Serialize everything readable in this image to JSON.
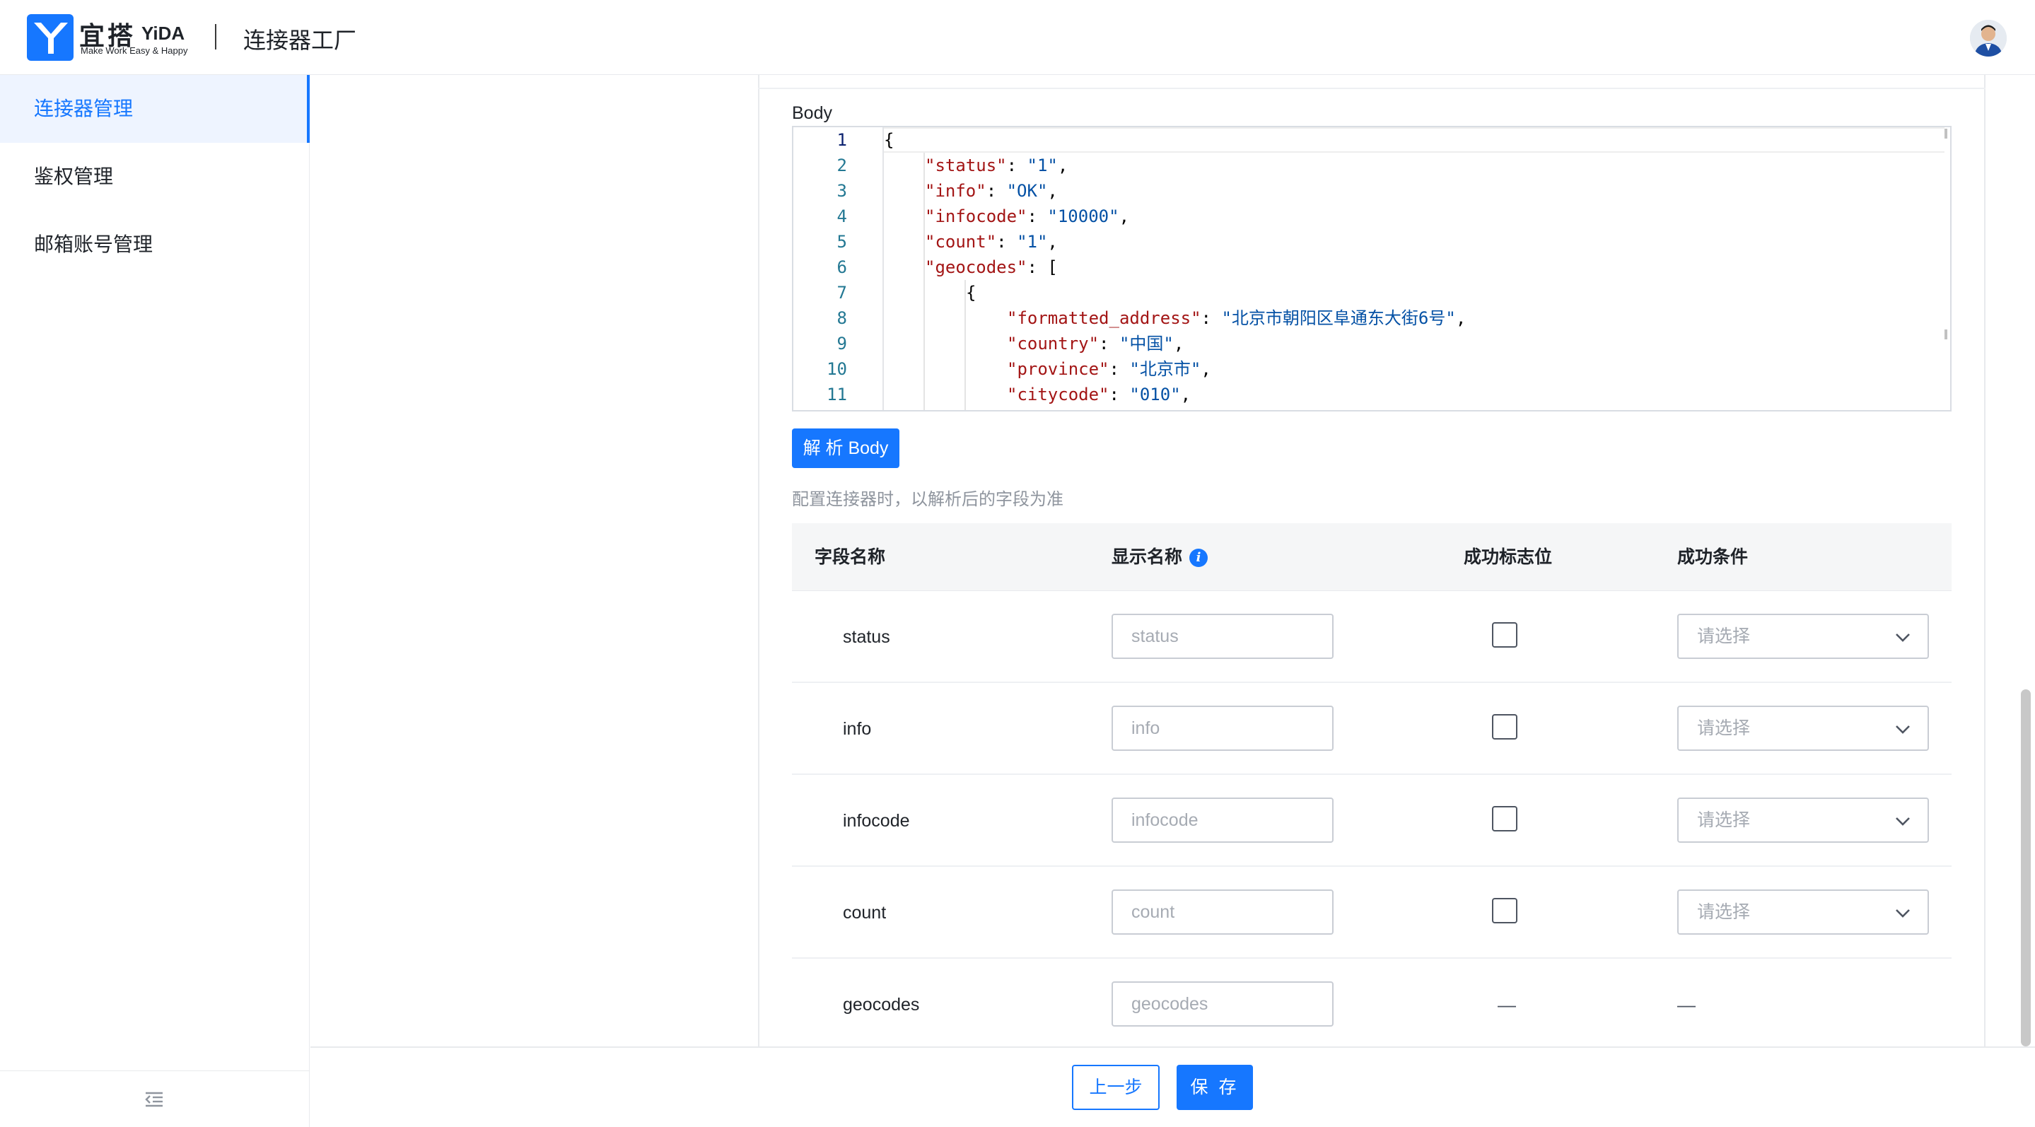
{
  "header": {
    "logo_cn": "宜搭",
    "logo_en": "YiDA",
    "logo_tagline": "Make Work Easy & Happy",
    "app_title": "连接器工厂"
  },
  "sidebar": {
    "items": [
      {
        "label": "连接器管理",
        "active": true
      },
      {
        "label": "鉴权管理",
        "active": false
      },
      {
        "label": "邮箱账号管理",
        "active": false
      }
    ]
  },
  "body_editor": {
    "label": "Body",
    "lines": [
      {
        "no": "1"
      },
      {
        "no": "2"
      },
      {
        "no": "3"
      },
      {
        "no": "4"
      },
      {
        "no": "5"
      },
      {
        "no": "6"
      },
      {
        "no": "7"
      },
      {
        "no": "8"
      },
      {
        "no": "9"
      },
      {
        "no": "10"
      },
      {
        "no": "11"
      }
    ],
    "code": {
      "l1": "{",
      "l2_key": "\"status\"",
      "l2_val": "\"1\"",
      "l3_key": "\"info\"",
      "l3_val": "\"OK\"",
      "l4_key": "\"infocode\"",
      "l4_val": "\"10000\"",
      "l5_key": "\"count\"",
      "l5_val": "\"1\"",
      "l6_key": "\"geocodes\"",
      "l6_rest": ": [",
      "l7": "{",
      "l8_key": "\"formatted_address\"",
      "l8_val": "\"北京市朝阳区阜通东大街6号\"",
      "l9_key": "\"country\"",
      "l9_val": "\"中国\"",
      "l10_key": "\"province\"",
      "l10_val": "\"北京市\"",
      "l11_key": "\"citycode\"",
      "l11_val": "\"010\""
    }
  },
  "parse_button": "解 析 Body",
  "hint": "配置连接器时，以解析后的字段为准",
  "table": {
    "headers": {
      "field_name": "字段名称",
      "display_name": "显示名称",
      "success_flag": "成功标志位",
      "success_condition": "成功条件"
    },
    "rows": [
      {
        "field": "status",
        "display_placeholder": "status",
        "select_placeholder": "请选择"
      },
      {
        "field": "info",
        "display_placeholder": "info",
        "select_placeholder": "请选择"
      },
      {
        "field": "infocode",
        "display_placeholder": "infocode",
        "select_placeholder": "请选择"
      },
      {
        "field": "count",
        "display_placeholder": "count",
        "select_placeholder": "请选择"
      },
      {
        "field": "geocodes",
        "display_placeholder": "geocodes",
        "flag": "—",
        "condition": "—"
      }
    ]
  },
  "footer": {
    "prev_label": "上一步",
    "save_label": "保 存"
  },
  "colors": {
    "primary": "#1677ff",
    "json_key": "#a31515",
    "json_string": "#0451a5"
  }
}
